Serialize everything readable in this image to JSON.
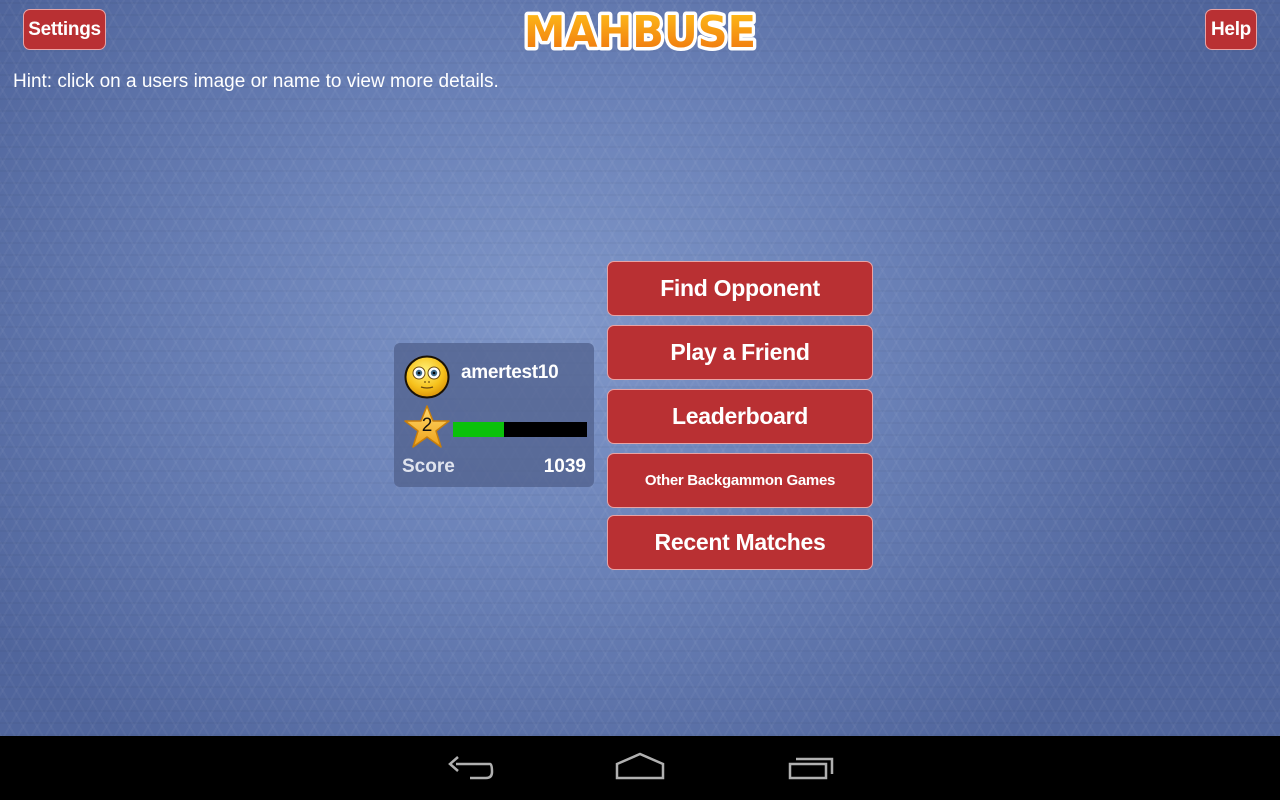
{
  "app": {
    "title": "MAHBUSE"
  },
  "header": {
    "settings_label": "Settings",
    "help_label": "Help",
    "logo_text": "MAHBUSE"
  },
  "hint": "Hint: click on a users image or name to view more details.",
  "profile": {
    "username": "amertest10",
    "level": "2",
    "xp_progress_percent": 38,
    "score_label": "Score",
    "score_value": "1039",
    "avatar_icon": "smiley-face-icon",
    "level_icon": "star-icon"
  },
  "menu": [
    {
      "id": "find-opponent",
      "label": "Find Opponent"
    },
    {
      "id": "play-friend",
      "label": "Play a Friend"
    },
    {
      "id": "leaderboard",
      "label": "Leaderboard"
    },
    {
      "id": "other-games",
      "label": "Other Backgammon Games"
    },
    {
      "id": "recent-matches",
      "label": "Recent Matches"
    }
  ],
  "colors": {
    "button_red": "#b93033",
    "xp_green": "#0ac10a",
    "logo_orange": "#f08a10"
  },
  "navbar": {
    "icons": [
      "back-icon",
      "home-icon",
      "recent-apps-icon"
    ]
  }
}
